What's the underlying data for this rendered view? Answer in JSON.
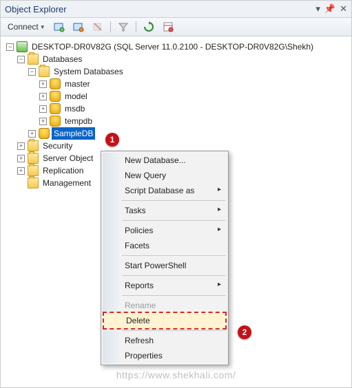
{
  "window": {
    "title": "Object Explorer"
  },
  "toolbar": {
    "connect_label": "Connect",
    "icons": [
      "connect",
      "disconnect",
      "stop",
      "policy",
      "filter",
      "refresh",
      "summary"
    ]
  },
  "tree": {
    "server_label": "DESKTOP-DR0V82G (SQL Server 11.0.2100 - DESKTOP-DR0V82G\\Shekh)",
    "databases_label": "Databases",
    "system_db_label": "System Databases",
    "system_dbs": [
      "master",
      "model",
      "msdb",
      "tempdb"
    ],
    "user_db_selected": "SampleDB",
    "other_nodes": [
      "Security",
      "Server Object",
      "Replication",
      "Management"
    ]
  },
  "context_menu": {
    "items": [
      {
        "label": "New Database...",
        "arrow": false
      },
      {
        "label": "New Query",
        "arrow": false
      },
      {
        "label": "Script Database as",
        "arrow": true
      },
      "sep",
      {
        "label": "Tasks",
        "arrow": true
      },
      "sep",
      {
        "label": "Policies",
        "arrow": true
      },
      {
        "label": "Facets",
        "arrow": false
      },
      "sep",
      {
        "label": "Start PowerShell",
        "arrow": false
      },
      "sep",
      {
        "label": "Reports",
        "arrow": true
      },
      "sep",
      {
        "label": "Rename",
        "arrow": false,
        "disabled": true
      },
      {
        "label": "Delete",
        "arrow": false,
        "highlight": true
      },
      "sep",
      {
        "label": "Refresh",
        "arrow": false
      },
      {
        "label": "Properties",
        "arrow": false
      }
    ]
  },
  "callouts": {
    "one": "1",
    "two": "2"
  },
  "watermark": "https://www.shekhali.com/"
}
